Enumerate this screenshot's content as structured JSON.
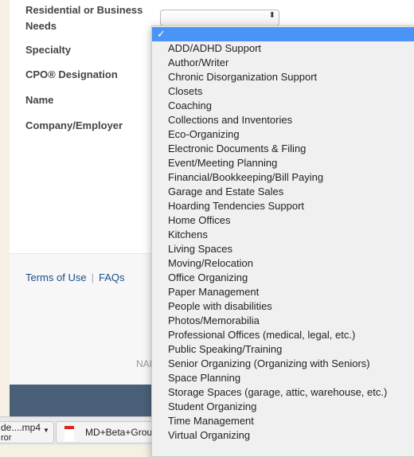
{
  "form": {
    "labels": [
      "Residential or Business",
      "Needs",
      "Specialty",
      "CPO® Designation",
      "Name",
      "Company/Employer"
    ]
  },
  "footer": {
    "terms": "Terms of Use",
    "separator": "|",
    "faqs": "FAQs",
    "partial_text": "NAI"
  },
  "downloads": [
    {
      "name": "de....mp4",
      "sub": "ror"
    },
    {
      "name": "MD+Beta+Group"
    }
  ],
  "dropdown": {
    "selected_mark": "✓",
    "accent": "#4a94f8",
    "options": [
      "ADD/ADHD Support",
      "Author/Writer",
      "Chronic Disorganization Support",
      "Closets",
      "Coaching",
      "Collections and Inventories",
      "Eco-Organizing",
      "Electronic Documents & Filing",
      "Event/Meeting Planning",
      "Financial/Bookkeeping/Bill Paying",
      "Garage and Estate Sales",
      "Hoarding Tendencies Support",
      "Home Offices",
      "Kitchens",
      "Living Spaces",
      "Moving/Relocation",
      "Office Organizing",
      "Paper Management",
      "People with disabilities",
      "Photos/Memorabilia",
      "Professional Offices (medical, legal, etc.)",
      "Public Speaking/Training",
      "Senior Organizing (Organizing with Seniors)",
      "Space Planning",
      "Storage Spaces (garage, attic, warehouse, etc.)",
      "Student Organizing",
      "Time Management",
      "Virtual Organizing"
    ]
  }
}
